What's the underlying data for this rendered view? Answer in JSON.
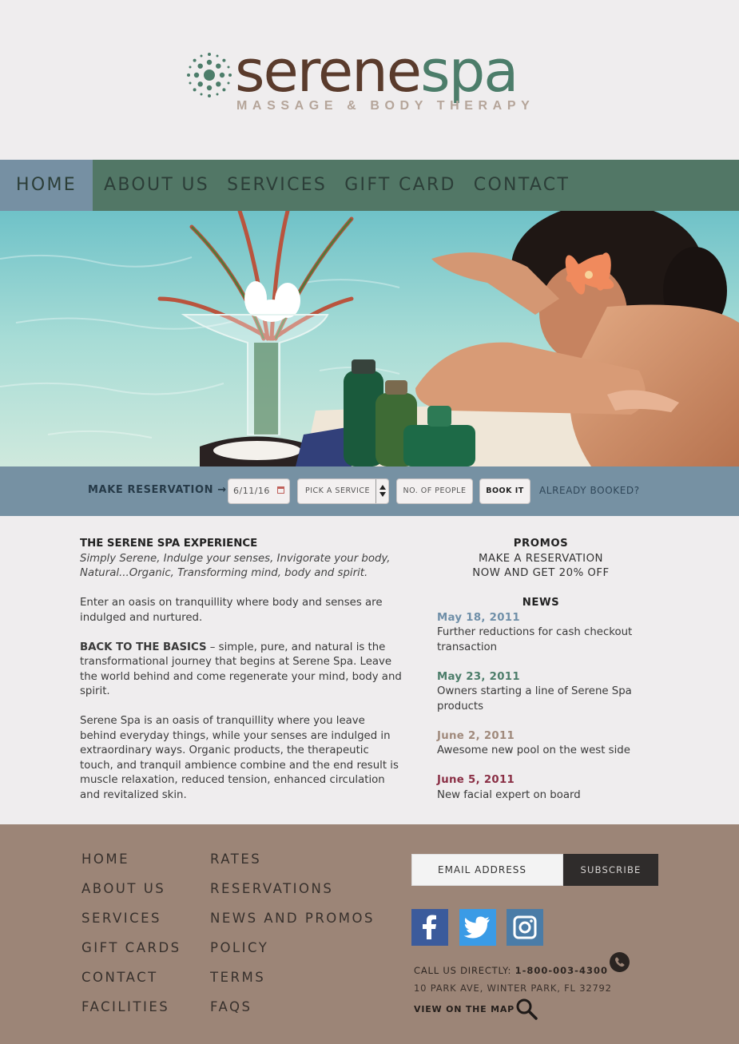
{
  "brand": {
    "name_part1": "serene",
    "name_part2": "spa",
    "tagline": "MASSAGE & BODY THERAPY"
  },
  "nav": {
    "items": [
      {
        "label": "HOME",
        "active": true
      },
      {
        "label": "ABOUT US",
        "active": false
      },
      {
        "label": "SERVICES",
        "active": false
      },
      {
        "label": "GIFT CARD",
        "active": false
      },
      {
        "label": "CONTACT",
        "active": false
      }
    ]
  },
  "reservation": {
    "label": "MAKE RESERVATION →",
    "date_value": "6/11/16",
    "service_placeholder": "PICK A SERVICE",
    "people_placeholder": "NO. OF PEOPLE",
    "book_label": "BOOK IT",
    "already_booked": "ALREADY BOOKED?"
  },
  "content": {
    "experience_title": "THE SERENE SPA EXPERIENCE",
    "experience_tagline": "Simply Serene, Indulge your senses, Invigorate your body, Natural...Organic, Transforming mind, body and spirit.",
    "intro": "Enter an oasis on tranquillity where body and senses are indulged and nurtured.",
    "basics_title": "BACK TO THE BASICS",
    "basics_text": " – simple, pure, and natural is the transformational journey that begins at Serene Spa. Leave the world behind and come regenerate your mind, body and spirit.",
    "oasis_text": "Serene Spa is an oasis of tranquillity where you leave behind everyday things, while your senses are indulged in extraordinary ways.  Organic products, the therapeutic touch, and tranquil ambience combine and the end result is muscle relaxation, reduced tension, enhanced circulation and revitalized skin."
  },
  "promos": {
    "title": "PROMOS",
    "line1": "MAKE A RESERVATION",
    "line2": "NOW AND GET 20% OFF"
  },
  "news": {
    "title": "NEWS",
    "items": [
      {
        "date": "May 18, 2011",
        "text": "Further reductions for cash checkout transaction",
        "color": "#6f8fa8"
      },
      {
        "date": "May 23, 2011",
        "text": "Owners starting a line of Serene Spa products",
        "color": "#4c7d6a"
      },
      {
        "date": "June 2, 2011",
        "text": "Awesome new pool on the west side",
        "color": "#a08a7c"
      },
      {
        "date": "June 5, 2011",
        "text": "New facial expert on board",
        "color": "#8a2f45"
      }
    ]
  },
  "footer": {
    "col1": [
      "HOME",
      "ABOUT US",
      "SERVICES",
      "GIFT CARDS",
      "CONTACT",
      "FACILITIES"
    ],
    "col2": [
      "RATES",
      "RESERVATIONS",
      "NEWS AND PROMOS",
      "POLICY",
      "TERMS",
      "FAQS"
    ],
    "email_placeholder": "EMAIL ADDRESS",
    "subscribe_label": "SUBSCRIBE",
    "call_label": "CALL US DIRECTLY: ",
    "phone": "1-800-003-4300",
    "address": "10 PARK AVE, WINTER PARK, FL 32792",
    "map_label": "VIEW ON THE MAP",
    "social": [
      "facebook-icon",
      "twitter-icon",
      "instagram-icon"
    ]
  },
  "colors": {
    "nav_bg": "#527766",
    "nav_active": "#7690a3",
    "resbar_bg": "#7691a3",
    "footer_bg": "#9c8577",
    "brand_brown": "#5a3b2c",
    "brand_green": "#4c7d6a"
  }
}
